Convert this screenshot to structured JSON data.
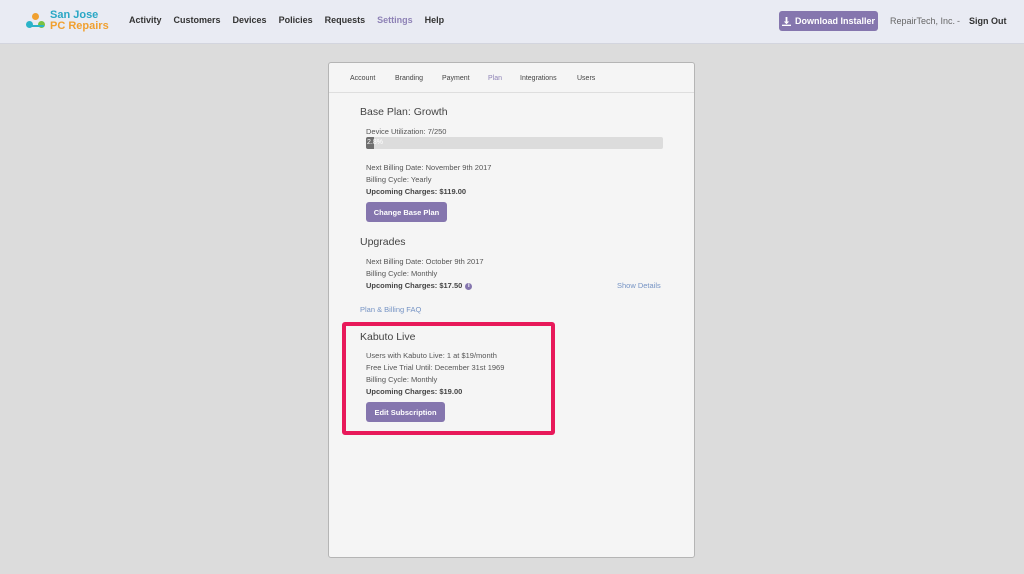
{
  "header": {
    "logo": {
      "line1": "San Jose",
      "line2": "PC Repairs"
    },
    "nav": [
      {
        "label": "Activity",
        "active": false
      },
      {
        "label": "Customers",
        "active": false
      },
      {
        "label": "Devices",
        "active": false
      },
      {
        "label": "Policies",
        "active": false
      },
      {
        "label": "Requests",
        "active": false
      },
      {
        "label": "Settings",
        "active": true
      },
      {
        "label": "Help",
        "active": false
      }
    ],
    "download_button": "Download Installer",
    "company": "RepairTech, Inc.",
    "separator": "-",
    "sign_out": "Sign Out"
  },
  "tabs": [
    {
      "label": "Account",
      "active": false
    },
    {
      "label": "Branding",
      "active": false
    },
    {
      "label": "Payment",
      "active": false
    },
    {
      "label": "Plan",
      "active": true
    },
    {
      "label": "Integrations",
      "active": false
    },
    {
      "label": "Users",
      "active": false
    }
  ],
  "base_plan": {
    "title": "Base Plan: Growth",
    "device_utilization": "Device Utilization: 7/250",
    "progress_label": "2.8%",
    "progress_fraction": 0.028,
    "next_billing": "Next Billing Date: November 9th 2017",
    "billing_cycle": "Billing Cycle: Yearly",
    "upcoming_charges": "Upcoming Charges: $119.00",
    "button": "Change Base Plan"
  },
  "upgrades": {
    "title": "Upgrades",
    "next_billing": "Next Billing Date: October 9th 2017",
    "billing_cycle": "Billing Cycle: Monthly",
    "upcoming_charges": "Upcoming Charges: $17.50",
    "show_details": "Show Details"
  },
  "faq_link": "Plan & Billing FAQ",
  "kabuto_live": {
    "title": "Kabuto Live",
    "users": "Users with Kabuto Live: 1 at $19/month",
    "free_trial": "Free Live Trial Until: December 31st 1969",
    "billing_cycle": "Billing Cycle: Monthly",
    "upcoming_charges": "Upcoming Charges: $19.00",
    "button": "Edit Subscription"
  },
  "colors": {
    "accent": "#8576ae",
    "highlight": "#e8195a",
    "link": "#7593c4"
  }
}
